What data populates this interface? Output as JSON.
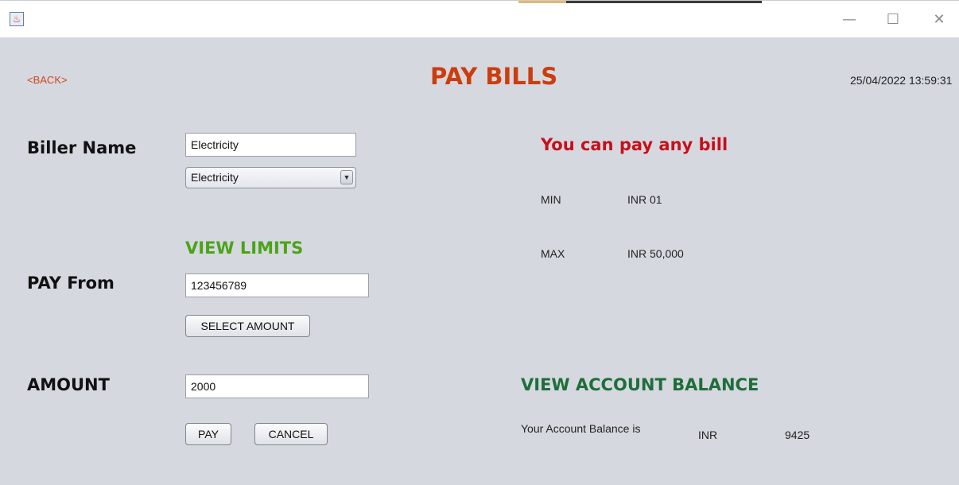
{
  "window": {
    "minimize_glyph": "—",
    "maximize_glyph": "☐",
    "close_glyph": "✕",
    "icon": "java-app-icon"
  },
  "header": {
    "back_label": "<BACK>",
    "title": "PAY BILLS",
    "datetime": "25/04/2022 13:59:31"
  },
  "biller": {
    "label": "Biller Name",
    "field_value": "Electricity",
    "dropdown_selected": "Electricity"
  },
  "limits": {
    "view_limits_label": "VIEW LIMITS",
    "heading": "You can pay any bill",
    "min_label": "MIN",
    "min_value": "INR 01",
    "max_label": "MAX",
    "max_value": "INR 50,000"
  },
  "pay_from": {
    "label": "PAY From",
    "value": "123456789",
    "select_amount_label": "SELECT AMOUNT"
  },
  "amount": {
    "label": "AMOUNT",
    "value": "2000",
    "pay_label": "PAY",
    "cancel_label": "CANCEL"
  },
  "balance": {
    "heading": "VIEW ACCOUNT BALANCE",
    "text": "Your Account Balance is",
    "currency": "INR",
    "value": "9425"
  },
  "colors": {
    "background": "#d5d8df",
    "title": "#cc3d0d",
    "green": "#4ca318",
    "red": "#c8101a",
    "dark_green": "#1f6e3a"
  }
}
